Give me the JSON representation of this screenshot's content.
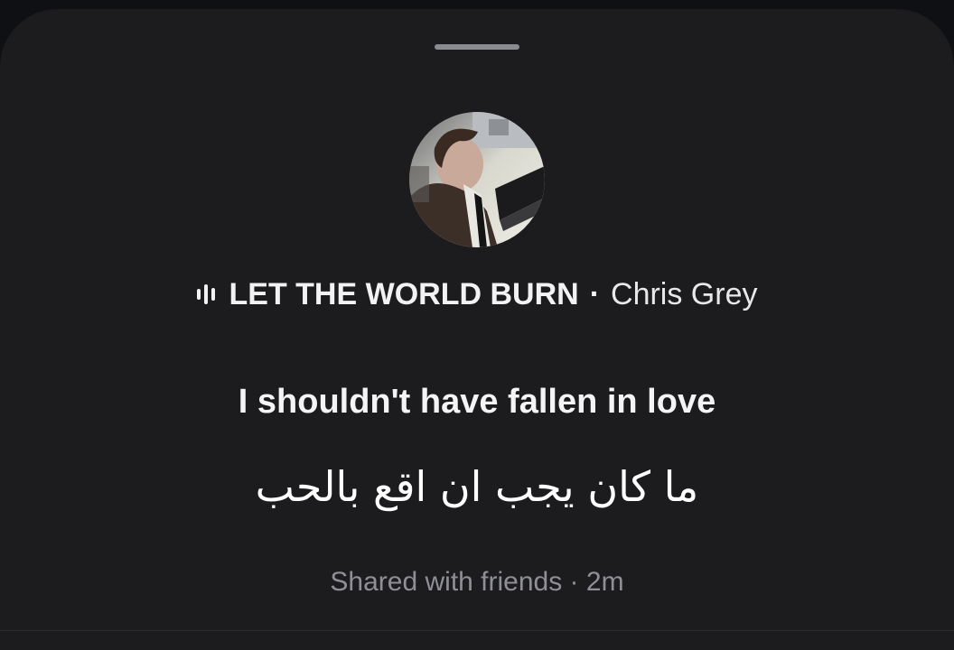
{
  "track": {
    "title": "LET THE WORLD BURN",
    "separator": "·",
    "artist": "Chris Grey",
    "playing_icon": "equalizer-bars-icon",
    "artwork": "artist-avatar"
  },
  "lyrics": {
    "original": "I shouldn't have fallen in love",
    "translation": "ما كان يجب ان اقع بالحب"
  },
  "meta": {
    "text": "Shared with friends · 2m"
  },
  "colors": {
    "background": "#0f1013",
    "sheet": "#1c1c1f",
    "primary_text": "#f2f2f4",
    "secondary_text": "#8f9096",
    "grabber": "#8a8b90"
  }
}
